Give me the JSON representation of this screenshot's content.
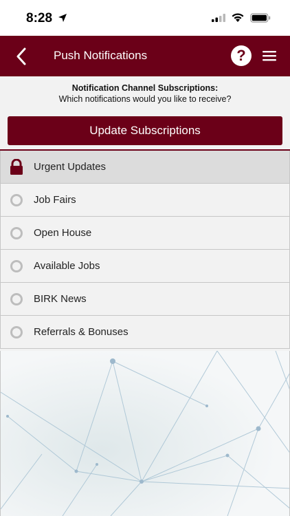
{
  "status_bar": {
    "time": "8:28",
    "icons": [
      "location-arrow-icon",
      "signal-icon",
      "wifi-icon",
      "battery-icon"
    ]
  },
  "header": {
    "title": "Push Notifications",
    "back_icon": "chevron-left-icon",
    "help_icon": "question-circle-icon",
    "menu_icon": "hamburger-menu-icon"
  },
  "intro": {
    "title": "Notification Channel Subscriptions:",
    "subtitle": "Which notifications would you like to receive?"
  },
  "update_button_label": "Update Subscriptions",
  "subscriptions": [
    {
      "label": "Urgent Updates",
      "state": "locked",
      "icon": "lock-icon"
    },
    {
      "label": "Job Fairs",
      "state": "unselected",
      "icon": "radio-icon"
    },
    {
      "label": "Open House",
      "state": "unselected",
      "icon": "radio-icon"
    },
    {
      "label": "Available Jobs",
      "state": "unselected",
      "icon": "radio-icon"
    },
    {
      "label": "BIRK News",
      "state": "unselected",
      "icon": "radio-icon"
    },
    {
      "label": "Referrals & Bonuses",
      "state": "unselected",
      "icon": "radio-icon"
    }
  ],
  "colors": {
    "brand": "#6b0018",
    "background": "#f2f2f2",
    "locked_row": "#dcdcdc",
    "radio": "#bdbdbd"
  }
}
